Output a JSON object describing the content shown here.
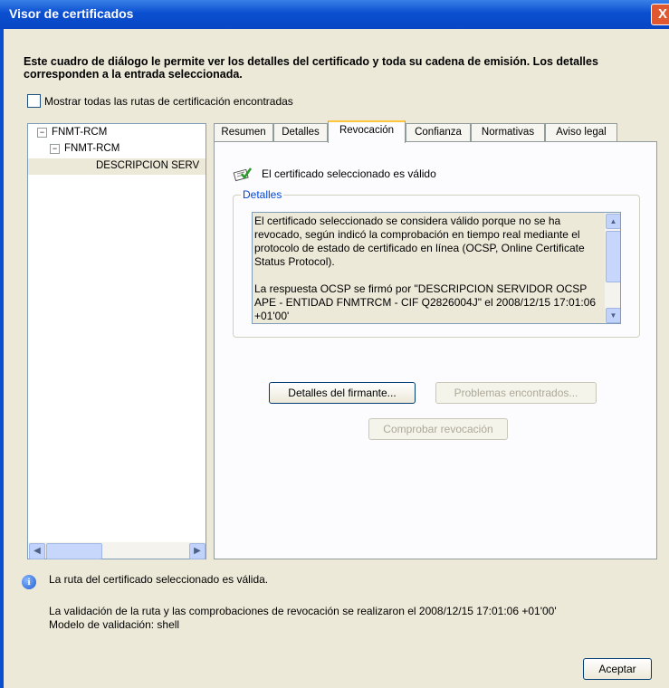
{
  "window": {
    "title": "Visor de certificados",
    "close_glyph": "X",
    "intro_text": "Este cuadro de diálogo le permite ver los detalles del certificado y toda su cadena de emisión. Los detalles corresponden a la entrada seleccionada.",
    "show_all_paths_label": "Mostrar todas las rutas de certificación encontradas"
  },
  "tree": {
    "items": [
      {
        "label": "FNMT-RCM",
        "expander": "−"
      },
      {
        "label": "FNMT-RCM",
        "expander": "−"
      },
      {
        "label": "DESCRIPCION SERV"
      }
    ]
  },
  "tabs": [
    {
      "label": "Resumen"
    },
    {
      "label": "Detalles"
    },
    {
      "label": "Revocación"
    },
    {
      "label": "Confianza"
    },
    {
      "label": "Normativas"
    },
    {
      "label": "Aviso legal"
    }
  ],
  "active_tab_index": 2,
  "revocation": {
    "status_text": "El certificado seleccionado es válido",
    "details_legend": "Detalles",
    "details_text_1": "El certificado seleccionado se considera válido porque no se ha revocado, según indicó la comprobación en tiempo real mediante el protocolo de estado de certificado en línea (OCSP, Online Certificate Status Protocol).",
    "details_text_2": "La respuesta OCSP se firmó por \"DESCRIPCION SERVIDOR OCSP APE - ENTIDAD FNMTRCM - CIF Q2826004J\" el 2008/12/15 17:01:06 +01'00'",
    "signer_details_button": "Detalles del firmante...",
    "problems_button": "Problemas encontrados...",
    "check_revocation_button": "Comprobar revocación"
  },
  "status": {
    "path_valid": "La ruta del certificado seleccionado es válida.",
    "validation_done": "La validación de la ruta y las comprobaciones de revocación se realizaron el 2008/12/15 17:01:06 +01'00'",
    "validation_model": "Modelo de validación: shell"
  },
  "accept_button": "Aceptar",
  "icons": {
    "info": "info-icon",
    "valid": "certificate-valid-icon",
    "close": "close-icon"
  }
}
